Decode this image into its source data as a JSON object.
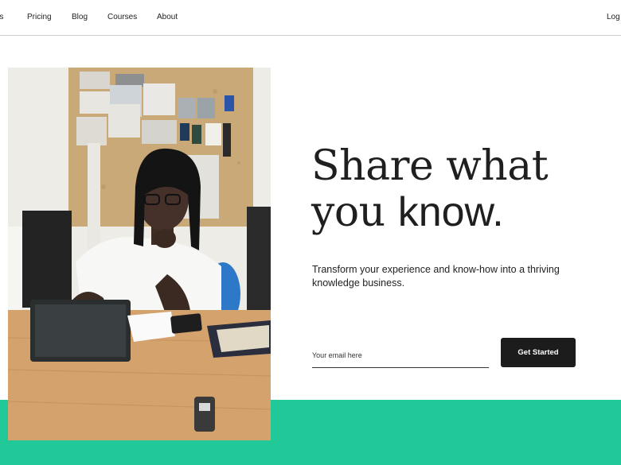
{
  "nav": {
    "items": [
      "es",
      "Pricing",
      "Blog",
      "Courses",
      "About"
    ],
    "login": "Log"
  },
  "hero": {
    "headline_line1": "Share what",
    "headline_line2_serif": "you ",
    "headline_line2_sans": "know.",
    "subtext": "Transform your experience and know-how into a thriving knowledge business.",
    "email_placeholder": "Your email here",
    "email_value": "",
    "cta_label": "Get Started"
  },
  "colors": {
    "accent_green": "#20c997",
    "button_dark": "#1c1c1c"
  },
  "image": {
    "semantic": "hero-photo-man-with-tablet"
  }
}
